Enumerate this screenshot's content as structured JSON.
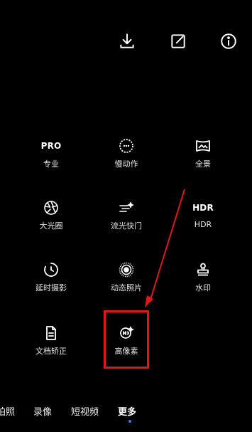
{
  "top_actions": [
    {
      "icon": "download-icon"
    },
    {
      "icon": "edit-square-icon"
    },
    {
      "icon": "info-icon"
    }
  ],
  "modes": {
    "pro": {
      "icon_text": "PRO",
      "label": "专业"
    },
    "slowmo": {
      "label": "慢动作",
      "icon": "slow-motion-icon"
    },
    "panorama": {
      "label": "全景",
      "icon": "panorama-icon"
    },
    "aperture": {
      "label": "大光圈",
      "icon": "aperture-icon"
    },
    "light_trail": {
      "label": "流光快门",
      "icon": "light-trail-icon"
    },
    "hdr": {
      "icon_text": "HDR",
      "label": "HDR"
    },
    "timelapse": {
      "label": "延时摄影",
      "icon": "timelapse-icon"
    },
    "live_photo": {
      "label": "动态照片",
      "icon": "live-photo-icon"
    },
    "watermark": {
      "label": "水印",
      "icon": "stamp-icon"
    },
    "document": {
      "label": "文档矫正",
      "icon": "document-icon"
    },
    "hi_res": {
      "label": "高像素",
      "icon": "hi-res-icon"
    }
  },
  "bottom_tabs": [
    {
      "label": "拍照"
    },
    {
      "label": "录像"
    },
    {
      "label": "短视频"
    },
    {
      "label": "更多",
      "active": true
    }
  ],
  "colors": {
    "highlight": "#e01717",
    "active_indicator": "#2d7cff",
    "background": "#000000"
  }
}
